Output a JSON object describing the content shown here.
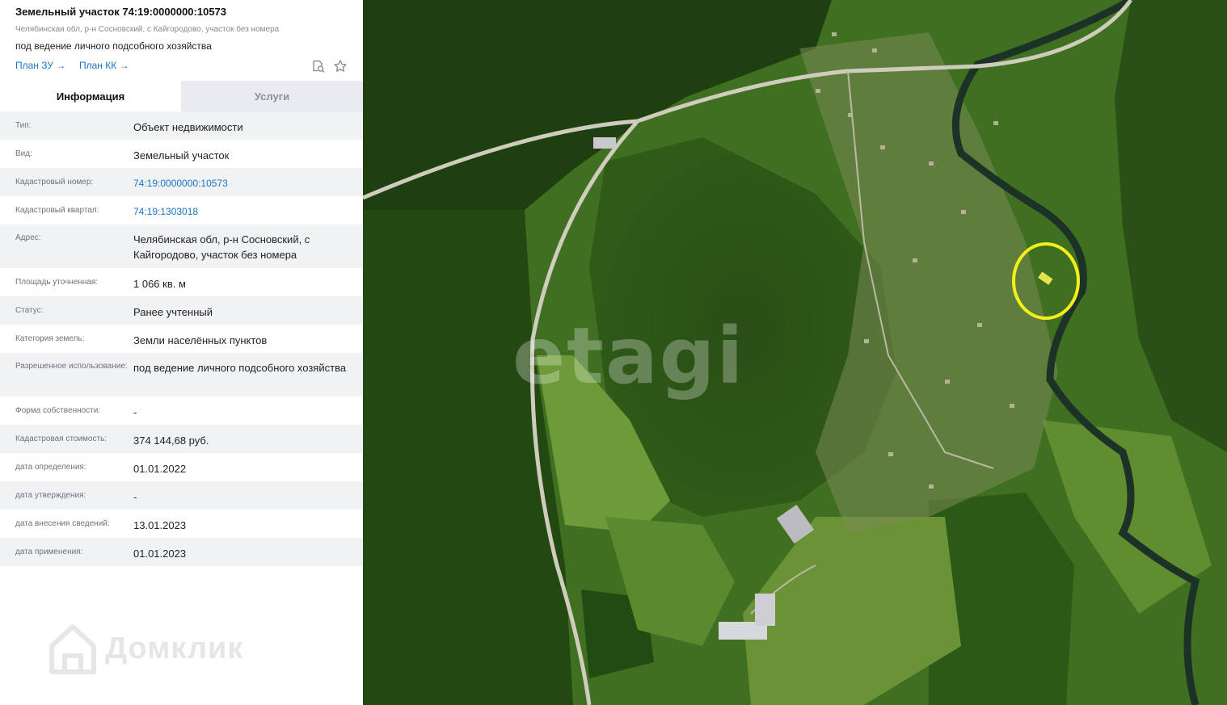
{
  "header": {
    "title": "Земельный участок 74:19:0000000:10573",
    "address": "Челябинская обл, р-н Сосновский, с Кайгородово, участок без номера",
    "usage": "под ведение личного подсобного хозяйства",
    "links": [
      {
        "label": "План ЗУ →"
      },
      {
        "label": "План КК →"
      }
    ],
    "icons": [
      "search-doc-icon",
      "star-icon"
    ]
  },
  "tabs": [
    {
      "label": "Информация",
      "active": true
    },
    {
      "label": "Услуги",
      "active": false
    }
  ],
  "rows": [
    {
      "label": "Тип:",
      "value": "Объект недвижимости"
    },
    {
      "label": "Вид:",
      "value": "Земельный участок"
    },
    {
      "label": "Кадастровый номер:",
      "value": "74:19:0000000:10573",
      "link": true
    },
    {
      "label": "Кадастровый квартал:",
      "value": "74:19:1303018",
      "link": true
    },
    {
      "label": "Адрес:",
      "value": "Челябинская обл, р-н Сосновский, с Кайгородово, участок без номера"
    },
    {
      "label": "Площадь уточненная:",
      "value": "1 066 кв. м"
    },
    {
      "label": "Статус:",
      "value": "Ранее учтенный"
    },
    {
      "label": "Категория земель:",
      "value": "Земли населённых пунктов"
    },
    {
      "label": "Разрешенное использование:",
      "value": "под ведение личного подсобного хозяйства"
    },
    {
      "label": "Форма собственности:",
      "value": "-"
    },
    {
      "label": "Кадастровая стоимость:",
      "value": "374 144,68 руб."
    },
    {
      "label": "дата определения:",
      "value": "01.01.2022"
    },
    {
      "label": "дата утверждения:",
      "value": "-"
    },
    {
      "label": "дата внесения сведений:",
      "value": "13.01.2023"
    },
    {
      "label": "дата применения:",
      "value": "01.01.2023"
    }
  ],
  "watermarks": {
    "domclick": "Домклик",
    "etagi": "etagi"
  },
  "colors": {
    "link": "#1a73c8",
    "highlight": "#f5ee1a",
    "tab_inactive_bg": "#e9ebee"
  }
}
